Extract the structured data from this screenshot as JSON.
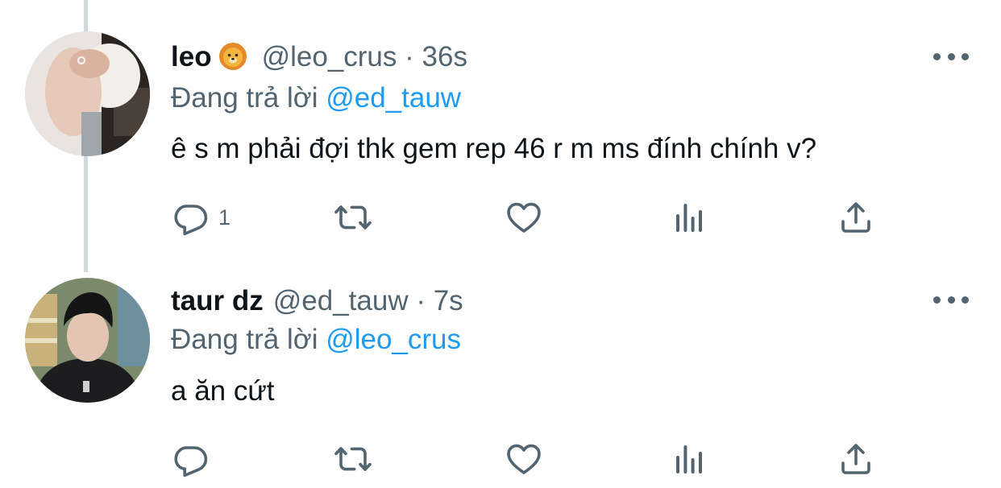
{
  "tweets": [
    {
      "name": "leo",
      "emoji": "lion-face-icon",
      "handle": "@leo_crus",
      "separator": "·",
      "time": "36s",
      "replying_prefix": "Đang trả lời",
      "replying_to": "@ed_tauw",
      "text": "ê s m phải đợi thk gem rep 46 r m ms đính chính v?",
      "reply_count": "1"
    },
    {
      "name": "taur dz",
      "handle": "@ed_tauw",
      "separator": "·",
      "time": "7s",
      "replying_prefix": "Đang trả lời",
      "replying_to": "@leo_crus",
      "text": "a ăn cứt",
      "reply_count": ""
    }
  ],
  "icons": {
    "reply": "reply-icon",
    "retweet": "retweet-icon",
    "like": "heart-icon",
    "views": "views-icon",
    "share": "share-icon",
    "more": "more-icon"
  },
  "colors": {
    "text": "#0f1419",
    "secondary": "#536471",
    "link": "#1d9bf0",
    "thread_line": "#cfd9de"
  }
}
